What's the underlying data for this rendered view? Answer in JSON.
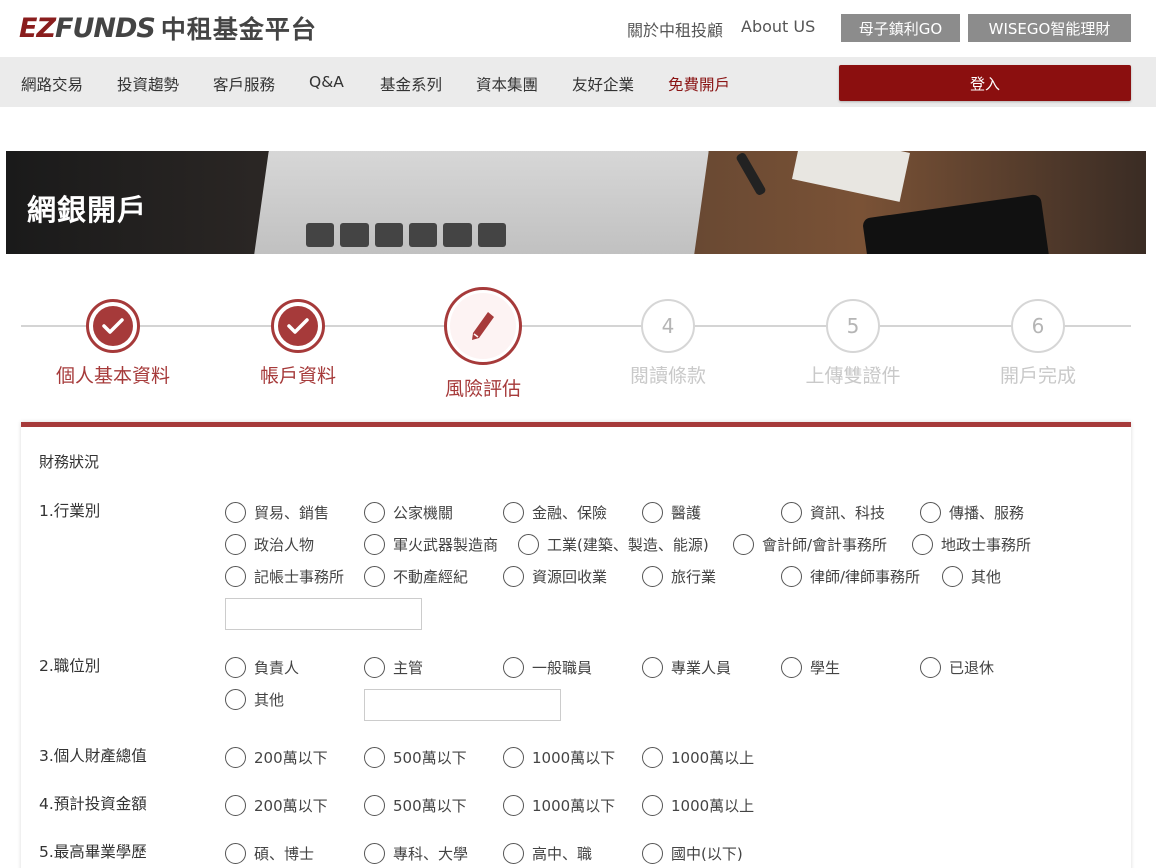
{
  "header": {
    "logo_ez": "EZ",
    "logo_funds": "FUNDS",
    "logo_cn": "中租基金平台",
    "links": [
      "關於中租投顧",
      "About US"
    ],
    "buttons": [
      "母子鎮利GO",
      "WISEGO智能理財"
    ]
  },
  "nav": {
    "items": [
      "網路交易",
      "投資趨勢",
      "客戶服務",
      "Q&A",
      "基金系列",
      "資本集團",
      "友好企業",
      "免費開戶"
    ],
    "login": "登入"
  },
  "banner": {
    "title": "網銀開戶"
  },
  "steps": [
    {
      "label": "個人基本資料",
      "state": "done"
    },
    {
      "label": "帳戶資料",
      "state": "done"
    },
    {
      "label": "風險評估",
      "state": "active"
    },
    {
      "label": "閱讀條款",
      "number": "4",
      "state": "pending"
    },
    {
      "label": "上傳雙證件",
      "number": "5",
      "state": "pending"
    },
    {
      "label": "開戶完成",
      "number": "6",
      "state": "pending"
    }
  ],
  "form": {
    "section_title": "財務狀況",
    "q1": {
      "label": "1.行業別",
      "options": [
        "貿易、銷售",
        "公家機關",
        "金融、保險",
        "醫護",
        "資訊、科技",
        "傳播、服務",
        "政治人物",
        "軍火武器製造商",
        "工業(建築、製造、能源)",
        "會計師/會計事務所",
        "地政士事務所",
        "記帳士事務所",
        "不動產經紀",
        "資源回收業",
        "旅行業",
        "律師/律師事務所",
        "其他"
      ],
      "other_value": ""
    },
    "q2": {
      "label": "2.職位別",
      "options": [
        "負責人",
        "主管",
        "一般職員",
        "專業人員",
        "學生",
        "已退休",
        "其他"
      ],
      "other_value": ""
    },
    "q3": {
      "label": "3.個人財產總值",
      "options": [
        "200萬以下",
        "500萬以下",
        "1000萬以下",
        "1000萬以上"
      ]
    },
    "q4": {
      "label": "4.預計投資金額",
      "options": [
        "200萬以下",
        "500萬以下",
        "1000萬以下",
        "1000萬以上"
      ]
    },
    "q5": {
      "label": "5.最高畢業學歷",
      "options": [
        "碩、博士",
        "專科、大學",
        "高中、職",
        "國中(以下)"
      ]
    }
  },
  "colors": {
    "brand": "#8b0f0f",
    "step_accent": "#a63a3a",
    "nav_bg": "#ebebeb",
    "top_button": "#8c8c8c"
  },
  "icons": [
    "check-icon",
    "pencil-icon"
  ]
}
